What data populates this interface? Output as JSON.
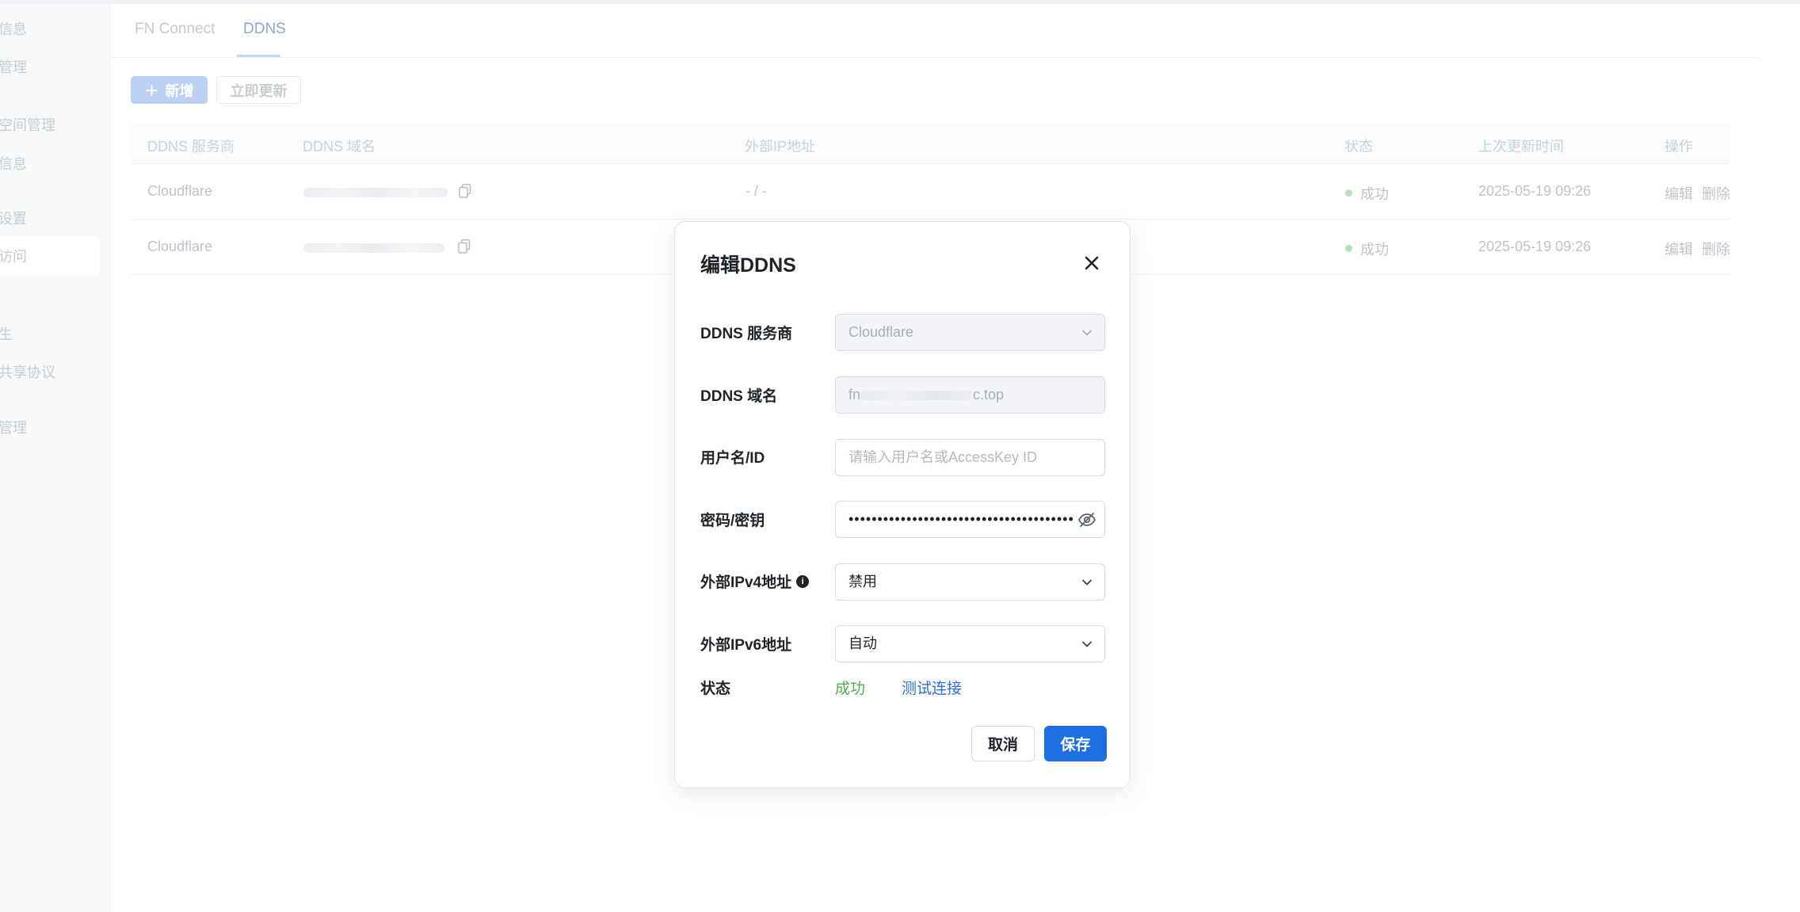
{
  "sidebar": {
    "items": [
      {
        "label": "信息"
      },
      {
        "label": "管理"
      },
      {
        "label": "空间管理"
      },
      {
        "label": "信息"
      },
      {
        "label": "设置"
      },
      {
        "label": "访问"
      },
      {
        "label": "生"
      },
      {
        "label": "共享协议"
      },
      {
        "label": "管理"
      }
    ]
  },
  "tabs": [
    {
      "label": "FN Connect"
    },
    {
      "label": "DDNS"
    }
  ],
  "toolbar": {
    "add_label": "新增",
    "update_label": "立即更新"
  },
  "table": {
    "columns": [
      "DDNS 服务商",
      "DDNS 域名",
      "外部IP地址",
      "状态",
      "上次更新时间",
      "操作"
    ],
    "rows": [
      {
        "provider": "Cloudflare",
        "ip": "- / -",
        "status": "成功",
        "updated": "2025-05-19 09:26",
        "edit": "编辑",
        "delete": "删除"
      },
      {
        "provider": "Cloudflare",
        "ip": "",
        "status": "成功",
        "updated": "2025-05-19 09:26",
        "edit": "编辑",
        "delete": "删除"
      }
    ]
  },
  "modal": {
    "title": "编辑DDNS",
    "fields": {
      "provider": {
        "label": "DDNS 服务商",
        "value": "Cloudflare"
      },
      "domain": {
        "label": "DDNS 域名",
        "value_start": "fn",
        "value_end": "c.top"
      },
      "username": {
        "label": "用户名/ID",
        "placeholder": "请输入用户名或AccessKey ID"
      },
      "password": {
        "label": "密码/密钥",
        "value": "•••••••••••••••••••••••••••••••••••••••"
      },
      "ipv4": {
        "label": "外部IPv4地址",
        "value": "禁用"
      },
      "ipv6": {
        "label": "外部IPv6地址",
        "value": "自动"
      },
      "status": {
        "label": "状态",
        "value": "成功",
        "test_link": "测试连接"
      }
    },
    "cancel_label": "取消",
    "save_label": "保存"
  },
  "colors": {
    "primary": "#1f6ee0",
    "success": "#52a850",
    "link": "#2f6fd1"
  }
}
